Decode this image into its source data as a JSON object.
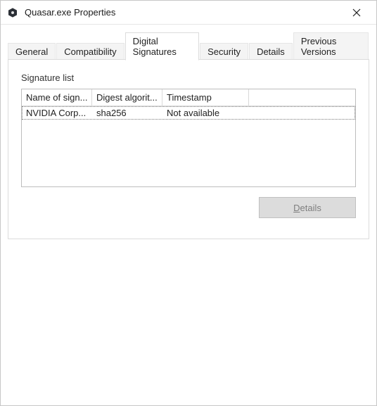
{
  "window": {
    "title": "Quasar.exe Properties"
  },
  "tabs": {
    "t0": "General",
    "t1": "Compatibility",
    "t2": "Digital Signatures",
    "t3": "Security",
    "t4": "Details",
    "t5": "Previous Versions",
    "active_index": 2
  },
  "signature_panel": {
    "label": "Signature list"
  },
  "listview": {
    "columns": {
      "c0": "Name of sign...",
      "c1": "Digest algorit...",
      "c2": "Timestamp"
    },
    "row0": {
      "signer": "NVIDIA Corp...",
      "digest": "sha256",
      "timestamp": "Not available"
    }
  },
  "buttons": {
    "details_prefix": "D",
    "details_rest": "etails"
  }
}
